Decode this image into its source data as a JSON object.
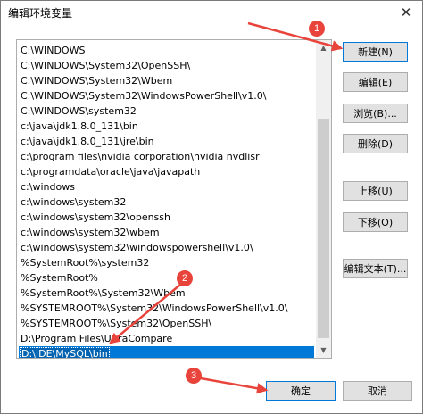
{
  "window": {
    "title": "编辑环境变量",
    "close_glyph": "✕"
  },
  "list": {
    "items": [
      "C:\\WINDOWS",
      "C:\\WINDOWS\\System32\\OpenSSH\\",
      "C:\\WINDOWS\\System32\\Wbem",
      "C:\\WINDOWS\\System32\\WindowsPowerShell\\v1.0\\",
      "C:\\WINDOWS\\system32",
      "c:\\java\\jdk1.8.0_131\\bin",
      "c:\\java\\jdk1.8.0_131\\jre\\bin",
      "c:\\program files\\nvidia corporation\\nvidia nvdlisr",
      "c:\\programdata\\oracle\\java\\javapath",
      "c:\\windows",
      "c:\\windows\\system32",
      "c:\\windows\\system32\\openssh",
      "c:\\windows\\system32\\wbem",
      "c:\\windows\\system32\\windowspowershell\\v1.0\\",
      "%SystemRoot%\\system32",
      "%SystemRoot%",
      "%SystemRoot%\\System32\\Wbem",
      "%SYSTEMROOT%\\System32\\WindowsPowerShell\\v1.0\\",
      "%SYSTEMROOT%\\System32\\OpenSSH\\",
      "D:\\Program Files\\UltraCompare"
    ],
    "selected_item": "D:\\IDE\\MySQL\\bin"
  },
  "buttons": {
    "new": "新建(N)",
    "edit": "编辑(E)",
    "browse": "浏览(B)...",
    "delete": "删除(D)",
    "move_up": "上移(U)",
    "move_down": "下移(O)",
    "edit_text": "编辑文本(T)...",
    "ok": "确定",
    "cancel": "取消"
  },
  "annotations": {
    "step1": "1",
    "step2": "2",
    "step3": "3",
    "color": "#e8443b"
  },
  "colors": {
    "selection": "#0078d7",
    "button_face": "#e1e1e1",
    "arrow": "#e8443b"
  }
}
